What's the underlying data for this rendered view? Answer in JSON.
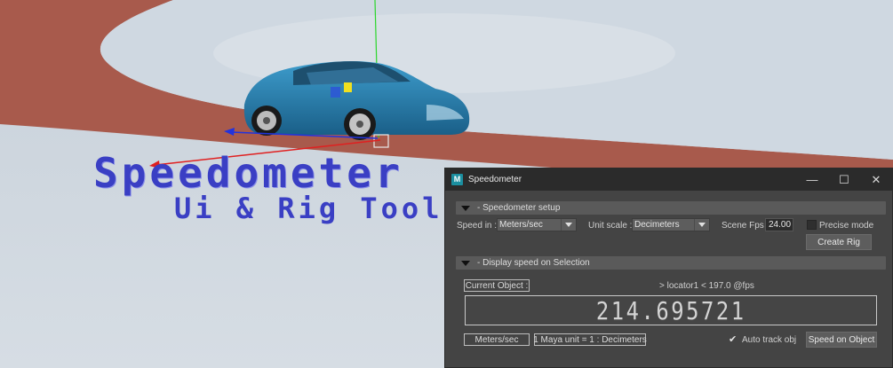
{
  "overlay": {
    "title": "Speedometer",
    "subtitle": "Ui & Rig Tool"
  },
  "window": {
    "title": "Speedometer",
    "app_icon": "M",
    "controls": {
      "minimize": "—",
      "maximize": "☐",
      "close": "✕"
    }
  },
  "setup": {
    "section_label": "- Speedometer setup",
    "speed_in_label": "Speed in :",
    "speed_in_value": "Meters/sec",
    "unit_scale_label": "Unit scale :",
    "unit_scale_value": "Decimeters",
    "scene_fps_label": "Scene Fps :",
    "scene_fps_value": "24.00",
    "precise_mode_label": "Precise mode",
    "precise_mode_checked": false,
    "create_rig_button": "Create Rig"
  },
  "display": {
    "section_label": "- Display speed on Selection",
    "current_object_label": "Current Object :",
    "object_info": ">  locator1  < 197.0 @fps",
    "speed_value": "214.695721",
    "unit_label": "Meters/sec",
    "scale_info": "1 Maya unit = 1 : Decimeters",
    "auto_track_label": "Auto track obj",
    "auto_track_checked": true,
    "check_glyph": "✔",
    "speed_on_object_button": "Speed on Object"
  },
  "colors": {
    "track": "#a85a4c",
    "car": "#2a7fb0",
    "title_text": "#3a3fc4",
    "window_bg": "#444444",
    "titlebar_bg": "#2b2b2b"
  }
}
